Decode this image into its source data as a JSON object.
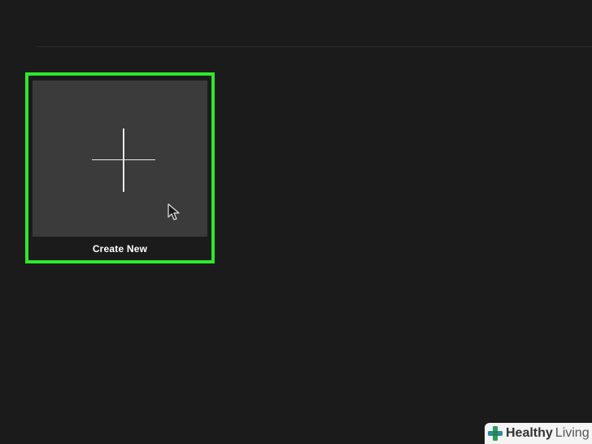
{
  "tile": {
    "label": "Create New"
  },
  "icons": {
    "plus": "plus-icon",
    "cursor": "mouse-pointer-icon",
    "watermark": "healthy-living-cross-icon"
  },
  "watermark": {
    "word1": "Healthy",
    "word2": "Living"
  },
  "colors": {
    "background": "#1b1b1b",
    "tile_background": "#3b3b3b",
    "highlight_border": "#2ee82e",
    "watermark_green": "#2e9e5b",
    "watermark_teal": "#2a8fa0"
  }
}
